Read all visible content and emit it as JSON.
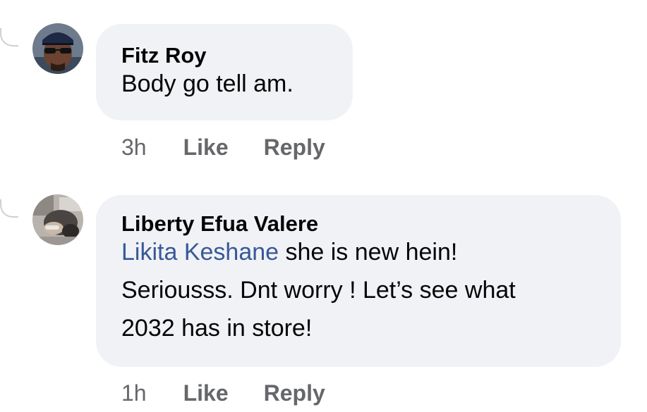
{
  "comments": [
    {
      "author": "Fitz Roy",
      "text": "Body go tell am.",
      "time": "3h",
      "like_label": "Like",
      "reply_label": "Reply"
    },
    {
      "author": "Liberty Efua Valere",
      "mention": "Likita Keshane",
      "text_line1_rest": " she is new hein!",
      "text_line2": "Seriousss. Dnt worry ! Let’s see what",
      "text_line3": "2032 has in store!",
      "time": "1h",
      "like_label": "Like",
      "reply_label": "Reply"
    }
  ],
  "colors": {
    "bubble_background": "#f0f2f5",
    "mention": "#385898",
    "meta_text": "#65676b"
  }
}
